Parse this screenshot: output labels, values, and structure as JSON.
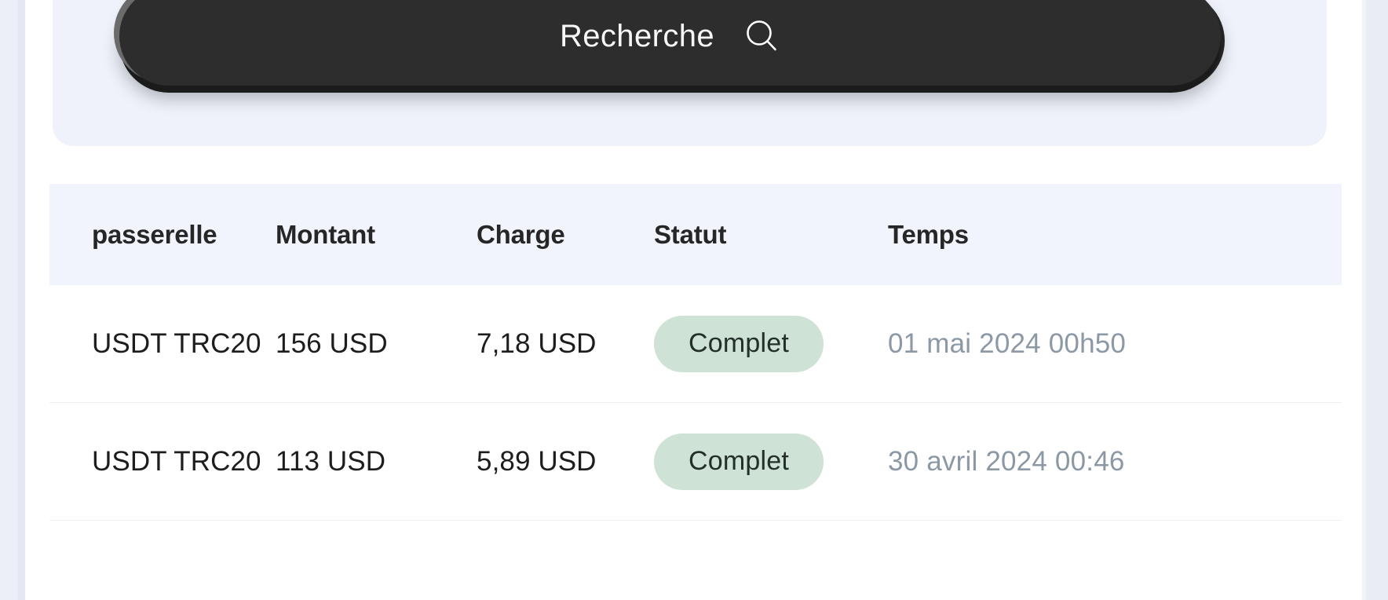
{
  "search": {
    "label": "Recherche",
    "icon": "search-icon",
    "button_color": "#2d2d2d",
    "text_color": "#f7f7f7"
  },
  "table": {
    "headers": [
      "passerelle",
      "Montant",
      "Charge",
      "Statut",
      "Temps"
    ],
    "header_bg": "#f1f4fd",
    "rows": [
      {
        "gateway": "USDT TRC20",
        "amount": "156 USD",
        "charge": "7,18 USD",
        "status": "Complet",
        "time": "01 mai 2024 00h50"
      },
      {
        "gateway": "USDT TRC20",
        "amount": "113 USD",
        "charge": "5,89 USD",
        "status": "Complet",
        "time": "30 avril 2024 00:46"
      }
    ],
    "status_badge_bg": "#cee2d6",
    "status_badge_text_color": "#23302a",
    "time_text_color": "#8b98a6"
  }
}
